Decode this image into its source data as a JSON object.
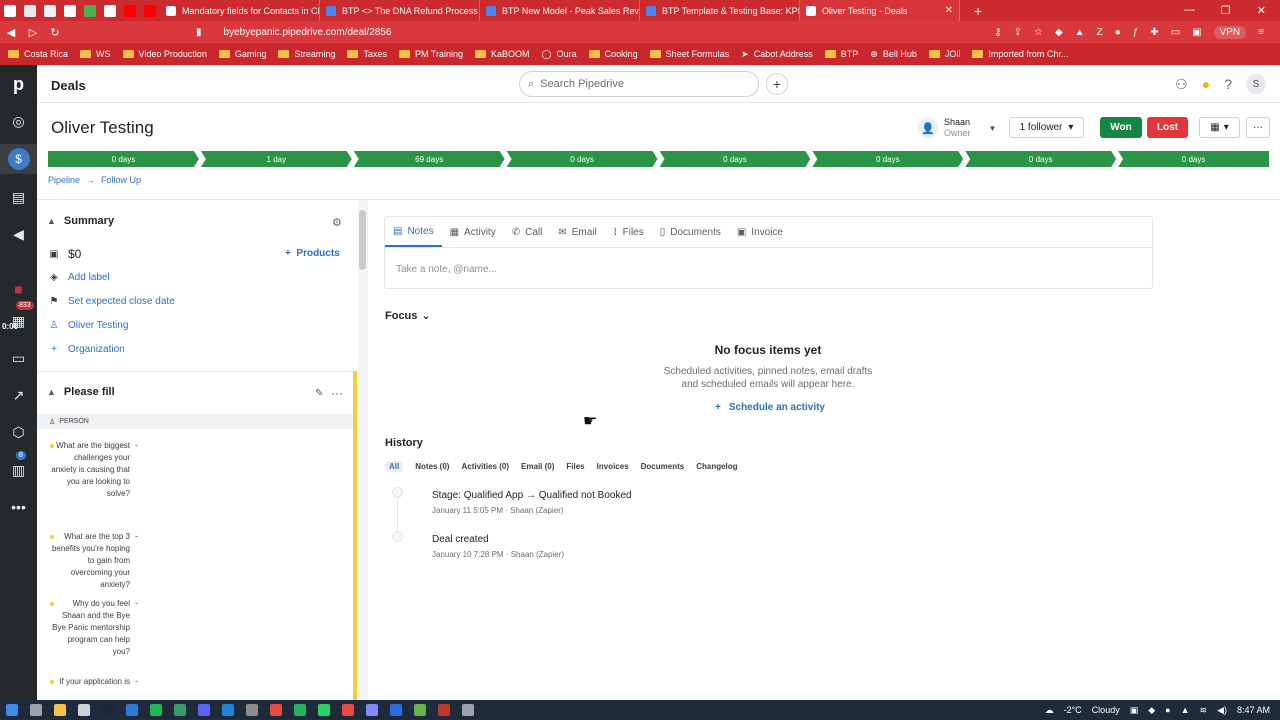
{
  "browser": {
    "tabs": [
      {
        "label": "Mandatory fields for Contacts in CRM",
        "active": false
      },
      {
        "label": "BTP <> The DNA Refund Process - Go",
        "active": false
      },
      {
        "label": "BTP New Model - Peak Sales Review C",
        "active": false
      },
      {
        "label": "BTP Template & Testing Base: KPIs - A",
        "active": false
      },
      {
        "label": "Oliver Testing - Deals",
        "active": true
      }
    ],
    "url": "byebyepanic.pipedrive.com/deal/2856",
    "vpn_label": "VPN",
    "bookmarks": [
      "Costa Rica",
      "WS",
      "Video Production",
      "Gaming",
      "Streaming",
      "Taxes",
      "PM Training",
      "KaBOOM",
      "Oura",
      "Cooking",
      "Sheet Formulas",
      "Cabot Address",
      "BTP",
      "Bell Hub",
      "JOli",
      "Imported from Chr..."
    ]
  },
  "nav": {
    "logo": "p",
    "timer": "0:00",
    "badge_mail": "833",
    "badge_more": "8"
  },
  "header": {
    "section_title": "Deals",
    "search_placeholder": "Search Pipedrive",
    "avatar_initial": "S"
  },
  "deal": {
    "title": "Oliver Testing",
    "owner_name": "Shaan",
    "owner_role": "Owner",
    "follower_label": "1 follower",
    "won_label": "Won",
    "lost_label": "Lost",
    "stages": [
      "0 days",
      "1 day",
      "69 days",
      "0 days",
      "0 days",
      "0 days",
      "0 days",
      "0 days"
    ],
    "breadcrumb": {
      "pipeline": "Pipeline",
      "stage": "Follow Up"
    }
  },
  "summary": {
    "title": "Summary",
    "value": "$0",
    "products_label": "Products",
    "add_label": "Add label",
    "close_date": "Set expected close date",
    "person": "Oliver Testing",
    "organization": "Organization"
  },
  "please_fill": {
    "title": "Please fill",
    "person_header": "PERSON",
    "questions": [
      {
        "q": "What are the biggest challenges your anxiety is causing that you are looking to solve?",
        "a": "-"
      },
      {
        "q": "What are the top 3 benefits you're hoping to gain from overcoming your anxiety?",
        "a": "-"
      },
      {
        "q": "Why do you feel Shaan and the Bye Bye Panic mentorship program can help you?",
        "a": "-"
      },
      {
        "q": "If your application is",
        "a": "-"
      }
    ]
  },
  "composer": {
    "tabs": [
      "Notes",
      "Activity",
      "Call",
      "Email",
      "Files",
      "Documents",
      "Invoice"
    ],
    "placeholder": "Take a note, @name..."
  },
  "focus": {
    "title": "Focus",
    "empty_title": "No focus items yet",
    "empty_sub_1": "Scheduled activities, pinned notes, email drafts",
    "empty_sub_2": "and scheduled emails will appear here.",
    "schedule_label": "Schedule an activity"
  },
  "history": {
    "title": "History",
    "filters": [
      "All",
      "Notes (0)",
      "Activities (0)",
      "Email (0)",
      "Files",
      "Invoices",
      "Documents",
      "Changelog"
    ],
    "items": [
      {
        "title": "Stage: Qualified App → Qualified not Booked",
        "meta": "January 11 5:05 PM · Shaan (Zapier)"
      },
      {
        "title": "Deal created",
        "meta": "January 10 7:28 PM · Shaan (Zapier)"
      }
    ]
  },
  "taskbar": {
    "temperature": "-2°C",
    "weather": "Cloudy",
    "time": "8:47 AM"
  }
}
